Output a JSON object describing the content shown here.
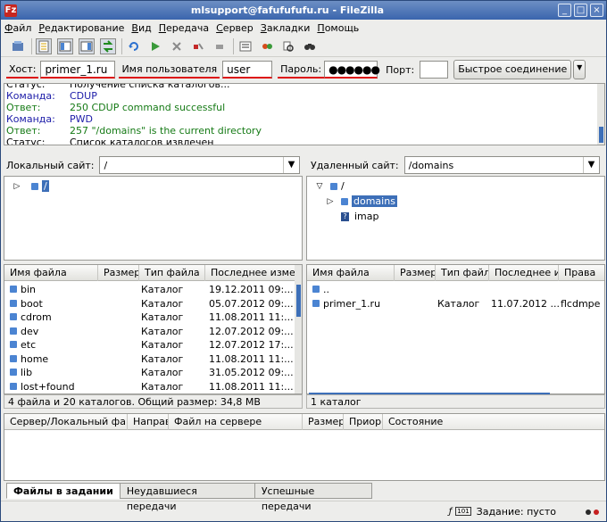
{
  "window": {
    "title": "mlsupport@fafufufufu.ru - FileZilla",
    "app_icon": "Fz",
    "controls": [
      "_",
      "□",
      "×"
    ]
  },
  "menu": [
    {
      "label": "Файл",
      "hotkey": "Ф",
      "rest": "айл"
    },
    {
      "label": "Редактирование",
      "hotkey": "Р",
      "rest": "едактирование"
    },
    {
      "label": "Вид",
      "hotkey": "В",
      "rest": "ид"
    },
    {
      "label": "Передача",
      "hotkey": "П",
      "rest": "ередача"
    },
    {
      "label": "Сервер",
      "hotkey": "С",
      "rest": "ервер"
    },
    {
      "label": "Закладки",
      "hotkey": "З",
      "rest": "акладки"
    },
    {
      "label": "Помощь",
      "hotkey": "П",
      "rest": "омощь"
    }
  ],
  "toolbar_icons": [
    "site-manager-icon",
    "toggle-log-icon",
    "toggle-local-tree-icon",
    "toggle-remote-tree-icon",
    "toggle-queue-icon",
    "refresh-icon",
    "process-queue-icon",
    "cancel-icon",
    "disconnect-icon",
    "reconnect-icon",
    "directory-listing-filters-icon",
    "toggle-sync-browsing-icon",
    "search-remote-files-icon",
    "find-icon"
  ],
  "quickconnect": {
    "host_label": "Хост:",
    "host_value": "primer_1.ru",
    "user_label": "Имя пользователя",
    "user_value": "user",
    "pass_label": "Пароль:",
    "pass_value": "●●●●●●",
    "port_label": "Порт:",
    "port_value": "",
    "connect_button": "Быстрое соединение"
  },
  "log": [
    {
      "kind": "Статус:",
      "text": "Получение списка каталогов...",
      "type": "status"
    },
    {
      "kind": "Команда:",
      "text": "CDUP",
      "type": "cmd"
    },
    {
      "kind": "Ответ:",
      "text": "250 CDUP command successful",
      "type": "ok"
    },
    {
      "kind": "Команда:",
      "text": "PWD",
      "type": "cmd"
    },
    {
      "kind": "Ответ:",
      "text": "257 \"/domains\" is the current directory",
      "type": "ok"
    },
    {
      "kind": "Статус:",
      "text": "Список каталогов извлечен",
      "type": "status"
    }
  ],
  "local": {
    "label": "Локальный сайт:",
    "path": "/",
    "tree": [
      {
        "label": "/",
        "selected": true
      }
    ],
    "columns": [
      "Имя файла",
      "Размер",
      "Тип файла",
      "Последнее изме"
    ],
    "files": [
      {
        "name": "bin",
        "size": "",
        "type": "Каталог",
        "modified": "19.12.2011 09:..."
      },
      {
        "name": "boot",
        "size": "",
        "type": "Каталог",
        "modified": "05.07.2012 09:..."
      },
      {
        "name": "cdrom",
        "size": "",
        "type": "Каталог",
        "modified": "11.08.2011 11:..."
      },
      {
        "name": "dev",
        "size": "",
        "type": "Каталог",
        "modified": "12.07.2012 09:..."
      },
      {
        "name": "etc",
        "size": "",
        "type": "Каталог",
        "modified": "12.07.2012 17:..."
      },
      {
        "name": "home",
        "size": "",
        "type": "Каталог",
        "modified": "11.08.2011 11:..."
      },
      {
        "name": "lib",
        "size": "",
        "type": "Каталог",
        "modified": "31.05.2012 09:..."
      },
      {
        "name": "lost+found",
        "size": "",
        "type": "Каталог",
        "modified": "11.08.2011 11:..."
      }
    ],
    "status": "4 файла и 20 каталогов. Общий размер: 34,8 MB"
  },
  "remote": {
    "label": "Удаленный сайт:",
    "path": "/domains",
    "tree": [
      {
        "label": "/",
        "level": 0,
        "expander": "▽"
      },
      {
        "label": "domains",
        "level": 1,
        "expander": "▷",
        "selected": true
      },
      {
        "label": "imap",
        "level": 1,
        "expander": "",
        "unknown": true
      }
    ],
    "columns": [
      "Имя файла",
      "Размер",
      "Тип файла",
      "Последнее из",
      "Права"
    ],
    "files": [
      {
        "name": "..",
        "size": "",
        "type": "",
        "modified": "",
        "perms": ""
      },
      {
        "name": "primer_1.ru",
        "size": "",
        "type": "Каталог",
        "modified": "11.07.2012 ...",
        "perms": "flcdmpe ..."
      }
    ],
    "status": "1 каталог"
  },
  "queue": {
    "columns": [
      "Сервер/Локальный файл",
      "Направ",
      "Файл на сервере",
      "Размер",
      "Приори",
      "Состояние"
    ]
  },
  "tabs": [
    {
      "label": "Файлы в задании",
      "active": true
    },
    {
      "label": "Неудавшиеся передачи",
      "active": false
    },
    {
      "label": "Успешные передачи",
      "active": false
    }
  ],
  "statusbar": {
    "queue_text": "Задание: пусто"
  }
}
